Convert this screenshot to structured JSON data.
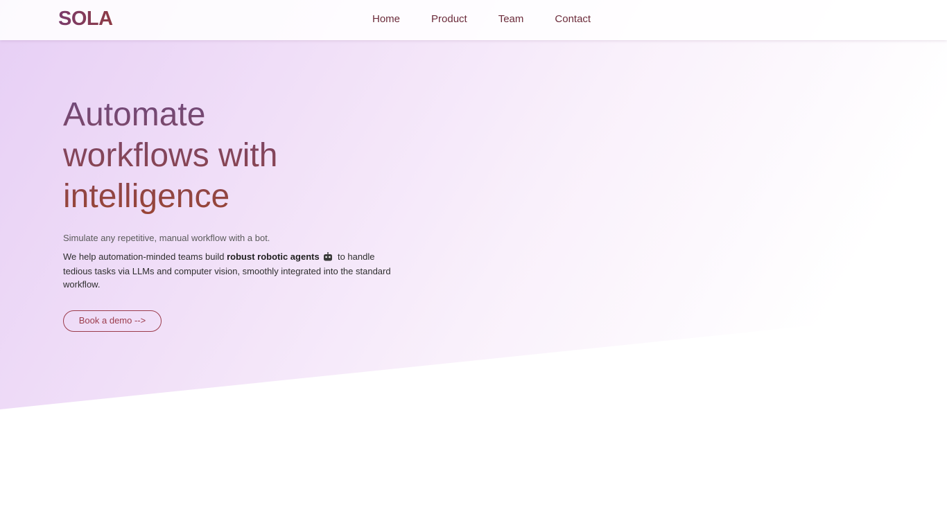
{
  "brand": {
    "logo_text": "SOLA"
  },
  "nav": {
    "items": [
      {
        "label": "Home"
      },
      {
        "label": "Product"
      },
      {
        "label": "Team"
      },
      {
        "label": "Contact"
      }
    ]
  },
  "hero": {
    "headline_line1": "Automate",
    "headline_line2": "workflows with",
    "headline_line3": "intelligence",
    "subtitle": "Simulate any repetitive, manual workflow with a bot.",
    "desc_prefix": "We help automation-minded teams build",
    "desc_bold": "robust robotic agents",
    "desc_icon": "robot-icon",
    "desc_suffix": "to handle tedious tasks via LLMs and computer vision, smoothly integrated into the standard workflow.",
    "cta_label": "Book a demo  -->"
  },
  "colors": {
    "brand_plum": "#7a3b6b",
    "brand_rust": "#9a4534",
    "cta_border": "#9b3b4b",
    "hero_gradient_start": "#e7cff5"
  }
}
